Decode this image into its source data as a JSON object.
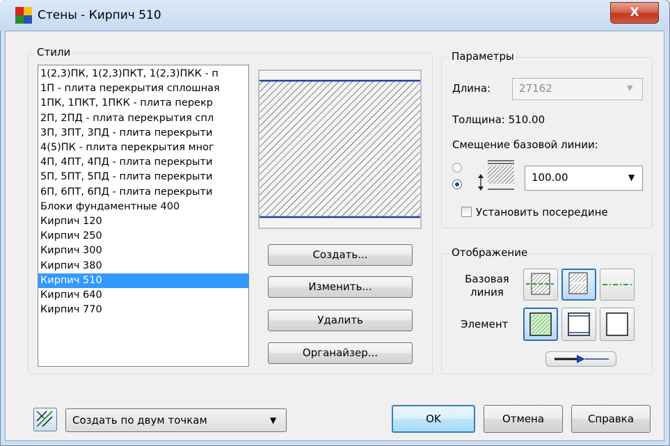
{
  "window": {
    "title": "Стены - Кирпич 510",
    "close_glyph": "X"
  },
  "styles_group": {
    "legend": "Стили",
    "items": [
      "1(2,3)ПК, 1(2,3)ПКТ, 1(2,3)ПКК - п",
      "1П - плита перекрытия сплошная",
      "1ПК, 1ПКТ, 1ПКК - плита перекр",
      "2П, 2ПД - плита перекрытия спл",
      "3П, 3ПТ, 3ПД - плита перекрыти",
      "4(5)ПК  - плита перекрытия мног",
      "4П, 4ПТ, 4ПД - плита перекрыти",
      "5П, 5ПТ, 5ПД - плита перекрыти",
      "6П, 6ПТ, 6ПД - плита перекрыти",
      "Блоки фундаментные 400",
      "Кирпич 120",
      "Кирпич 250",
      "Кирпич 300",
      "Кирпич 380",
      "Кирпич 510",
      "Кирпич 640",
      "Кирпич 770"
    ],
    "selected_index": 14
  },
  "buttons": {
    "create": "Создать...",
    "edit": "Изменить...",
    "delete": "Удалить",
    "organizer": "Органайзер..."
  },
  "params": {
    "legend": "Параметры",
    "length_label": "Длина:",
    "length_value": "27162",
    "thickness": "Толщина: 510.00",
    "offset_label": "Смещение базовой линии:",
    "offset_value": "100.00",
    "center_checkbox": "Установить посередине",
    "center_checked": false,
    "offset_mode_selected": 1
  },
  "display": {
    "legend": "Отображение",
    "baseline_label_1": "Базовая",
    "baseline_label_2": "линия",
    "element_label": "Элемент"
  },
  "footer": {
    "mode_value": "Создать по двум точкам",
    "ok": "OK",
    "cancel": "Отмена",
    "help": "Справка"
  },
  "colors": {
    "selection": "#3399ff",
    "accent_blue": "#1f3fa0",
    "baseline_green": "#2ea02e"
  }
}
